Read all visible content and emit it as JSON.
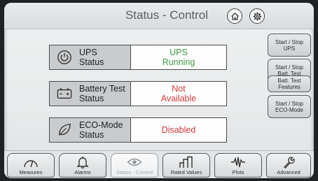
{
  "header": {
    "title": "Status - Control",
    "home_icon": "home-icon",
    "settings_icon": "gear-icon"
  },
  "rows": [
    {
      "label": "UPS\nStatus",
      "value": "UPS\nRunning",
      "icon": "power-icon",
      "value_color": "#3f9a43"
    },
    {
      "label": "Battery Test\nStatus",
      "value": "Not\nAvailable",
      "icon": "battery-icon",
      "value_color": "#d23a3a"
    },
    {
      "label": "ECO-Mode\nStatus",
      "value": "Disabled",
      "icon": "leaf-icon",
      "value_color": "#d23a3a"
    }
  ],
  "side_buttons": [
    {
      "label": "Start / Stop\nUPS"
    },
    {
      "label": "Start / Stop\nBatt. Test"
    },
    {
      "label": "Batt. Test\nFeatures"
    },
    {
      "label": "Start / Stop\nECO-Mode"
    }
  ],
  "tabs": [
    {
      "label": "Measures",
      "icon": "gauge-icon",
      "active": false
    },
    {
      "label": "Alarms",
      "icon": "bell-icon",
      "active": false
    },
    {
      "label": "Status - Control",
      "icon": "eye-icon",
      "active": true
    },
    {
      "label": "Rated Values",
      "icon": "bars-icon",
      "active": false
    },
    {
      "label": "Plots",
      "icon": "waveform-icon",
      "active": false
    },
    {
      "label": "Advanced",
      "icon": "wrench-icon",
      "active": false
    }
  ]
}
